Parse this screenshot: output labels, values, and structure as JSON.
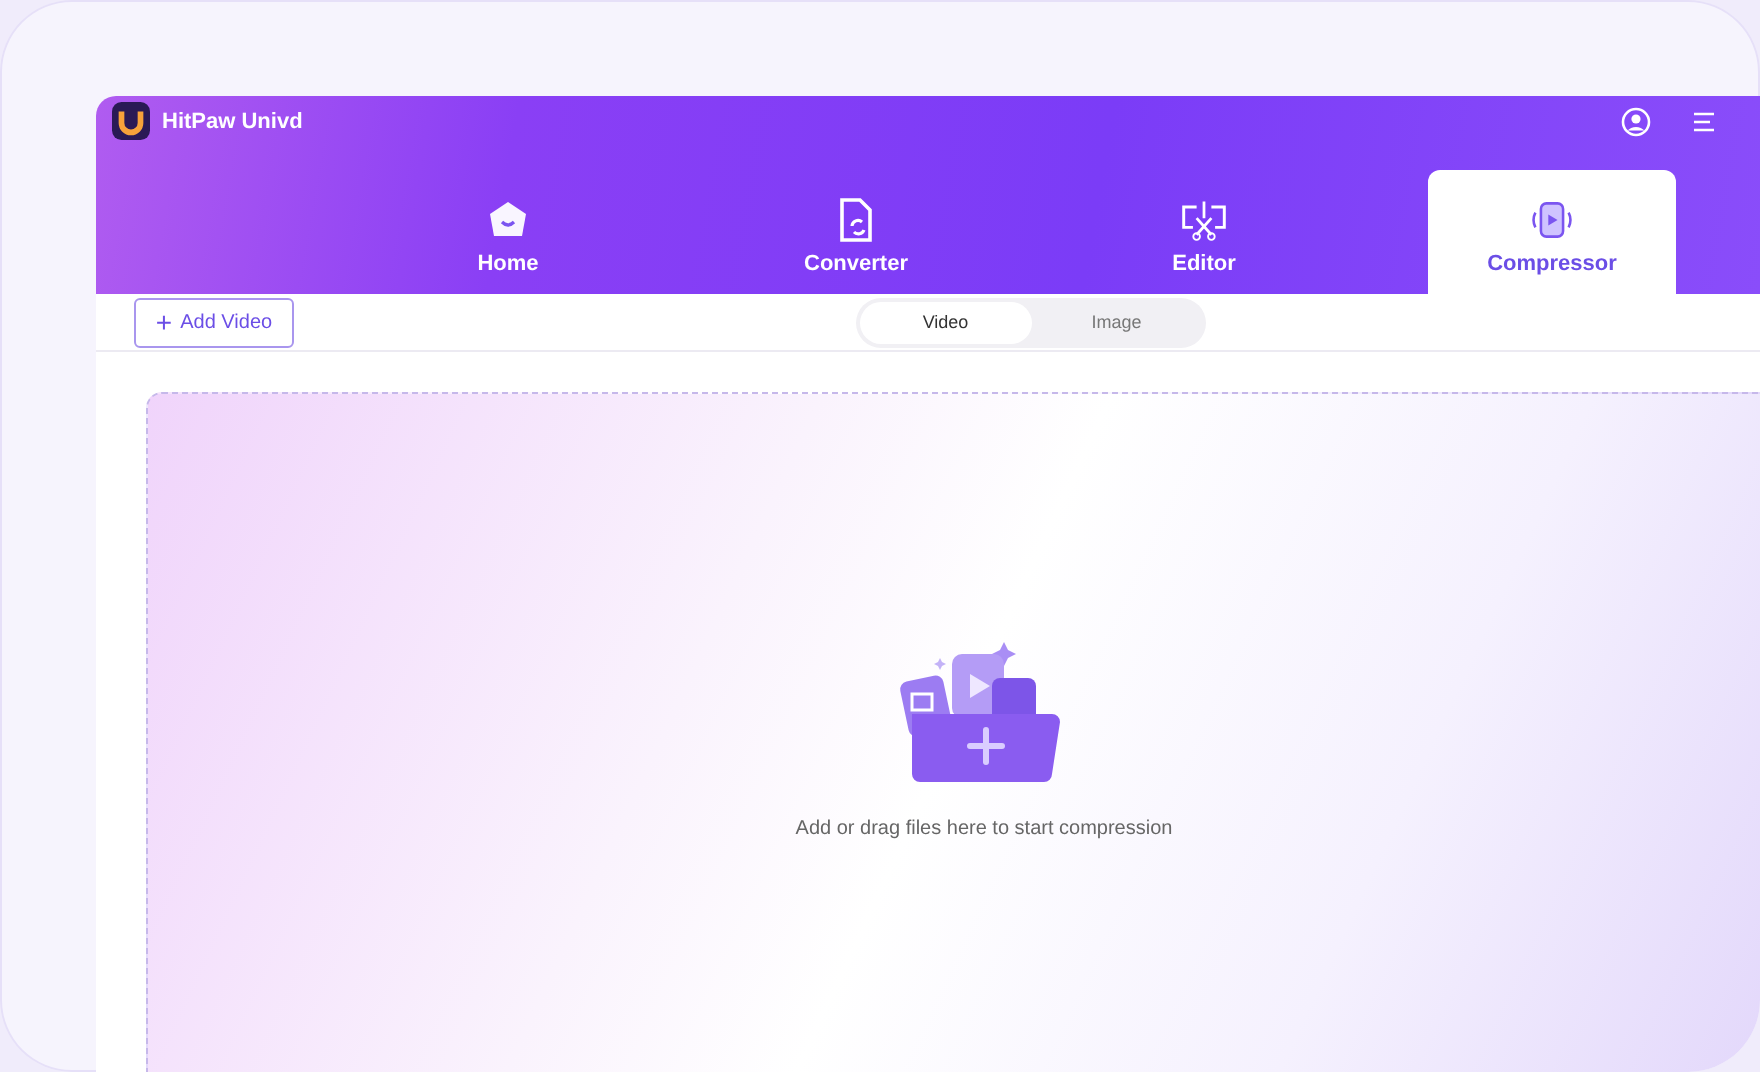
{
  "app": {
    "title": "HitPaw Univd"
  },
  "tabs": [
    {
      "label": "Home",
      "kind": "home",
      "selected": false
    },
    {
      "label": "Converter",
      "kind": "converter",
      "selected": false
    },
    {
      "label": "Editor",
      "kind": "editor",
      "selected": false
    },
    {
      "label": "Compressor",
      "kind": "compressor",
      "selected": true
    }
  ],
  "toolbar": {
    "add_button": "Add Video",
    "add_icon": "+",
    "modes": [
      {
        "label": "Video",
        "selected": true
      },
      {
        "label": "Image",
        "selected": false
      }
    ]
  },
  "drop_zone": {
    "hint": "Add or drag files here to start compression"
  }
}
